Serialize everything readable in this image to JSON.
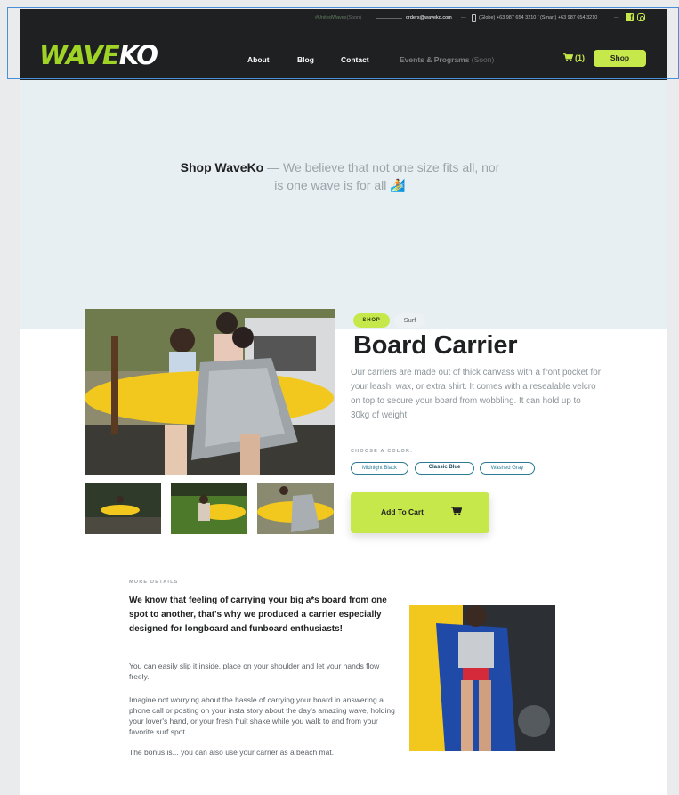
{
  "topbar": {
    "hashtag": "#UnitedWaves",
    "hashtag_soon": "(Soon)",
    "email": "orders@waveko.com",
    "dash": "—",
    "phone_text": "(Globe) +63 987 654 3210 / (Smart) +63 987 654 3210",
    "facebook_glyph": "f"
  },
  "nav": {
    "logo_wave": "WAVE",
    "logo_ko": "KO",
    "about": "About",
    "blog": "Blog",
    "contact": "Contact",
    "events": "Events & Programs",
    "events_soon": "(Soon)",
    "cart_count": "(1)",
    "shop": "Shop"
  },
  "hero": {
    "brand": "Shop WaveKo",
    "tagline": " — We believe that not one size fits all, nor is one wave is for all 🏄"
  },
  "product": {
    "tag_shop": "SHOP",
    "tag_surf": "Surf",
    "title": "Board Carrier",
    "description": "Our carriers are made out of thick canvass with a front pocket for your leash, wax, or extra shirt. It comes with a resealable velcro on top to secure your board from wobbling. It can hold up to 30kg of weight.",
    "color_label": "CHOOSE A COLOR:",
    "colors": [
      "Midnight Black",
      "Classic Blue",
      "Washed Gray"
    ],
    "selected_color": "Classic Blue",
    "add_to_cart": "Add To Cart"
  },
  "details": {
    "label": "MORE DETAILS",
    "lead": "We know that feeling of carrying your big a*s board from one spot to another, that's why we produced a carrier especially designed for longboard and funboard enthusiasts!",
    "p1": "You can easily slip it inside, place on your shoulder and let your hands flow freely.",
    "p2": "Imagine not worrying about the hassle of carrying your board in answering a phone call or posting on your insta story about the day's amazing wave, holding your lover's hand, or your fresh fruit shake while you walk to and from your favorite surf spot.",
    "p3": "The bonus is... you can also use your carrier as a beach mat."
  },
  "colors": {
    "accent": "#c6e84a",
    "logo_green": "#9fd326",
    "dark": "#1f2021",
    "hero_bg": "#e8eff3",
    "option_blue": "#2a7a95"
  },
  "icons": {
    "cart": "cart-icon",
    "phone": "phone-icon",
    "facebook": "facebook-icon",
    "instagram": "instagram-icon"
  }
}
